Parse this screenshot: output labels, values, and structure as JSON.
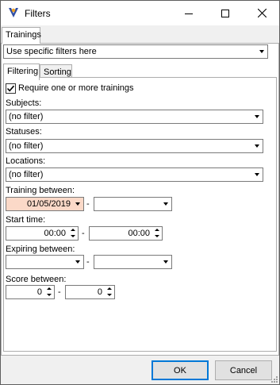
{
  "window": {
    "title": "Filters"
  },
  "tabs_outer": {
    "trainings": "Trainings"
  },
  "filter_mode": {
    "value": "Use specific filters here"
  },
  "tabs_inner": {
    "filtering": "Filtering",
    "sorting": "Sorting"
  },
  "require_training": {
    "label": "Require one or more trainings",
    "checked": true
  },
  "subjects": {
    "label": "Subjects:",
    "value": "(no filter)"
  },
  "statuses": {
    "label": "Statuses:",
    "value": "(no filter)"
  },
  "locations": {
    "label": "Locations:",
    "value": "(no filter)"
  },
  "training_between": {
    "label": "Training between:",
    "from": "01/05/2019",
    "to": "",
    "separator": "-"
  },
  "start_time": {
    "label": "Start time:",
    "from": "00:00",
    "to": "00:00",
    "separator": "-"
  },
  "expiring_between": {
    "label": "Expiring between:",
    "from": "",
    "to": "",
    "separator": "-"
  },
  "score_between": {
    "label": "Score between:",
    "from": "0",
    "to": "0",
    "separator": "-"
  },
  "footer": {
    "ok": "OK",
    "cancel": "Cancel"
  },
  "colors": {
    "date_highlight": "#fbd9c8",
    "accent": "#0078d7"
  }
}
